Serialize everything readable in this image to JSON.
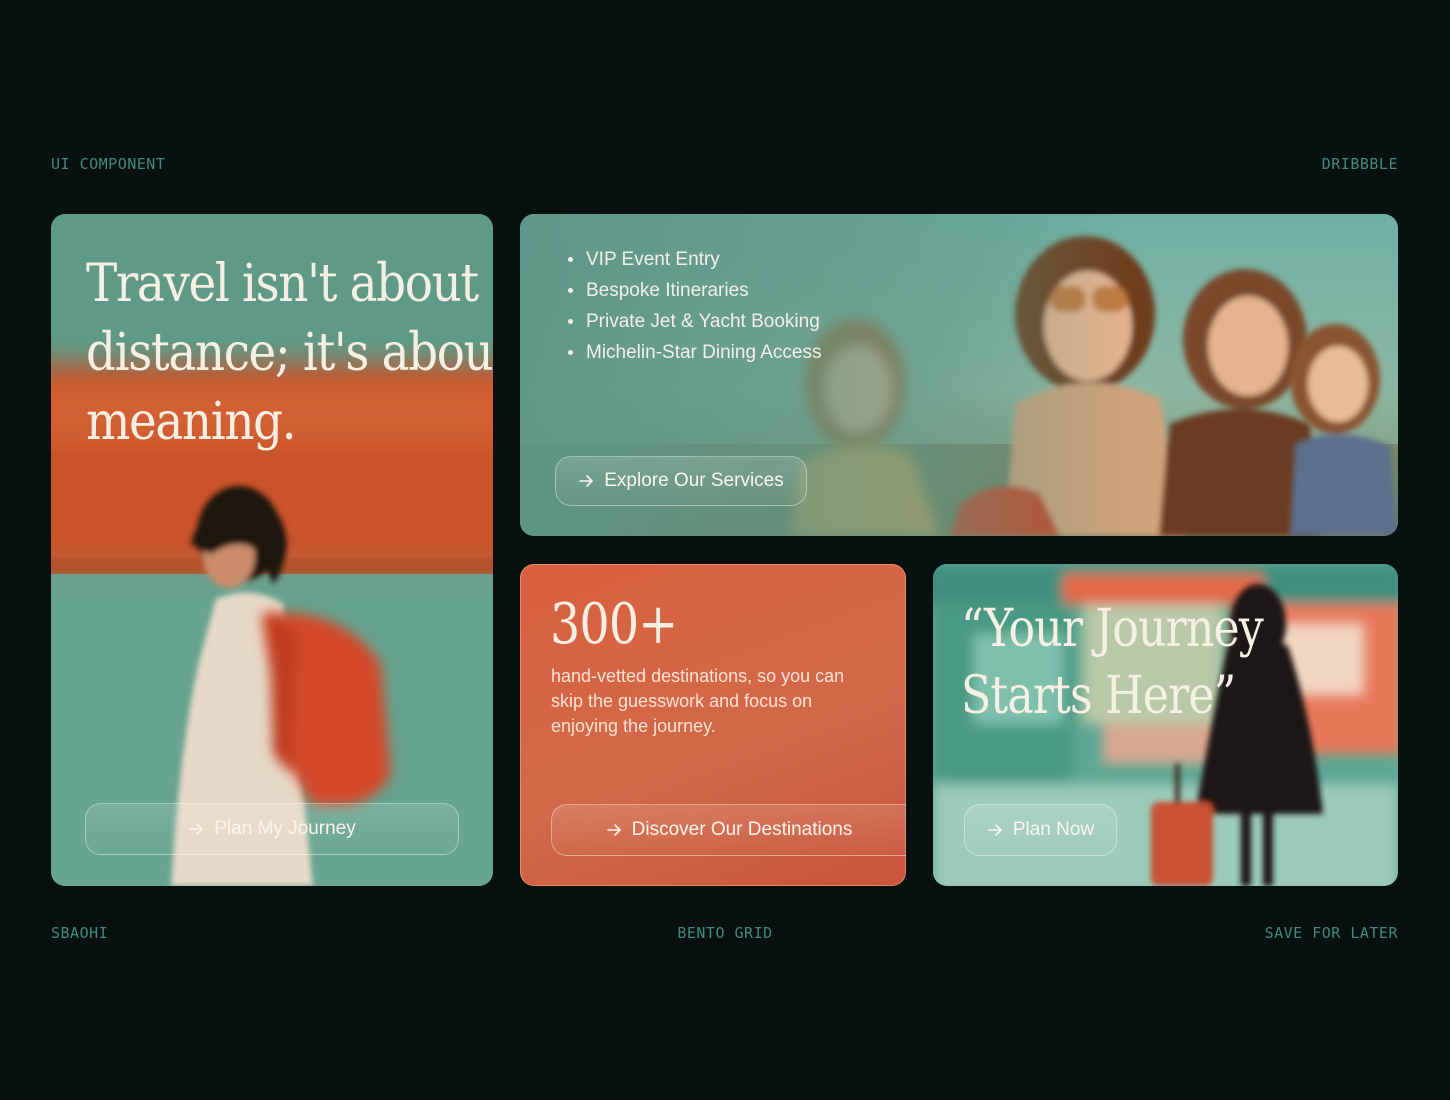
{
  "meta": {
    "top_left": "UI COMPONENT",
    "top_right": "DRIBBBLE",
    "bottom_left": "SBAOHI",
    "bottom_center": "BENTO GRID",
    "bottom_right": "SAVE FOR LATER"
  },
  "quote_card": {
    "lines": [
      "Travel isn't about",
      "distance; it's about",
      "meaning."
    ],
    "button_label": "Plan My Journey",
    "button_icon": "arrow-right-icon"
  },
  "services_card": {
    "items": [
      "VIP Event Entry",
      "Bespoke Itineraries",
      "Private Jet & Yacht Booking",
      "Michelin-Star Dining Access"
    ],
    "button_label": "Explore Our Services",
    "button_icon": "arrow-right-icon"
  },
  "stats_card": {
    "number": "300+",
    "description_lines": [
      "hand-vetted destinations, so you can",
      "skip the guesswork and focus on",
      "enjoying the journey."
    ],
    "button_label": "Discover Our Destinations",
    "button_icon": "arrow-right-icon"
  },
  "journey_card": {
    "lines": [
      "“Your Journey",
      "Starts Here”"
    ],
    "button_label": "Plan Now",
    "button_icon": "arrow-right-icon"
  },
  "colors": {
    "background": "#091110",
    "meta_text": "#3f8a79",
    "teal": "#5f9f8c",
    "orange": "#d9603e",
    "cream": "#f6efe4"
  }
}
